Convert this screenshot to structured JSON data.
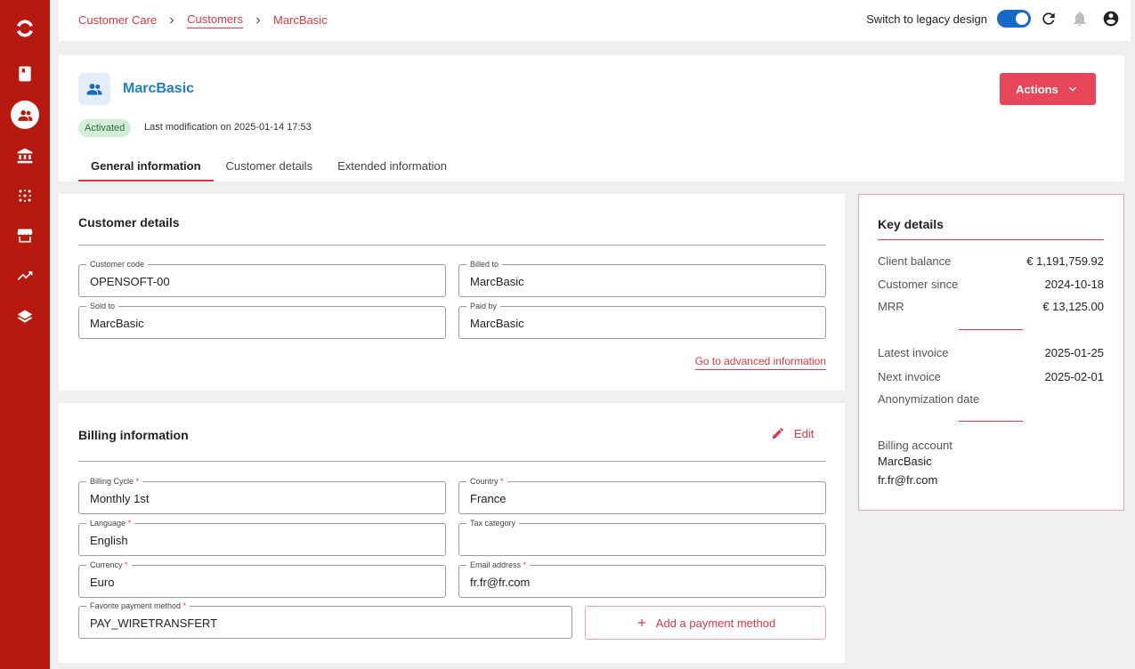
{
  "breadcrumb": [
    "Customer Care",
    "Customers",
    "MarcBasic"
  ],
  "topbar": {
    "legacy_label": "Switch to legacy design"
  },
  "customer": {
    "name": "MarcBasic",
    "status": "Activated",
    "last_modification": "Last modification on 2025-01-14 17:53",
    "actions_label": "Actions"
  },
  "tabs": [
    "General information",
    "Customer details",
    "Extended information"
  ],
  "customer_details": {
    "title": "Customer details",
    "fields": [
      {
        "label": "Customer code",
        "value": "OPENSOFT-00"
      },
      {
        "label": "Billed to",
        "value": "MarcBasic"
      },
      {
        "label": "Sold to",
        "value": "MarcBasic"
      },
      {
        "label": "Paid by",
        "value": "MarcBasic"
      }
    ],
    "advanced_link": "Go to advanced information"
  },
  "billing": {
    "title": "Billing information",
    "edit_label": "Edit",
    "fields": [
      {
        "label": "Billing Cycle",
        "value": "Monthly 1st",
        "required": "*"
      },
      {
        "label": "Country",
        "value": "France",
        "required": "*"
      },
      {
        "label": "Language",
        "value": "English",
        "required": "*"
      },
      {
        "label": "Tax category",
        "value": ""
      },
      {
        "label": "Currency",
        "value": "Euro",
        "required": "*"
      },
      {
        "label": "Email address",
        "value": "fr.fr@fr.com",
        "required": "*"
      },
      {
        "label": "Favorite payment method",
        "value": "PAY_WIRETRANSFERT",
        "required": "*"
      }
    ],
    "add_payment_label": "Add a payment method"
  },
  "key_details": {
    "title": "Key details",
    "group1": [
      {
        "label": "Client balance",
        "value": "€ 1,191,759.92"
      },
      {
        "label": "Customer since",
        "value": "2024-10-18"
      },
      {
        "label": "MRR",
        "value": "€ 13,125.00"
      }
    ],
    "group2": [
      {
        "label": "Latest invoice",
        "value": "2025-01-25"
      },
      {
        "label": "Next invoice",
        "value": "2025-02-01"
      },
      {
        "label": "Anonymization date",
        "value": ""
      }
    ],
    "billing_account_label": "Billing account",
    "billing_account_name": "MarcBasic",
    "billing_account_email": "fr.fr@fr.com"
  },
  "colors": {
    "sidebar": "#b8190e",
    "accent": "#d6394a",
    "button": "#e8475a",
    "link_blue": "#1f7dc4",
    "toggle": "#1769c9"
  }
}
